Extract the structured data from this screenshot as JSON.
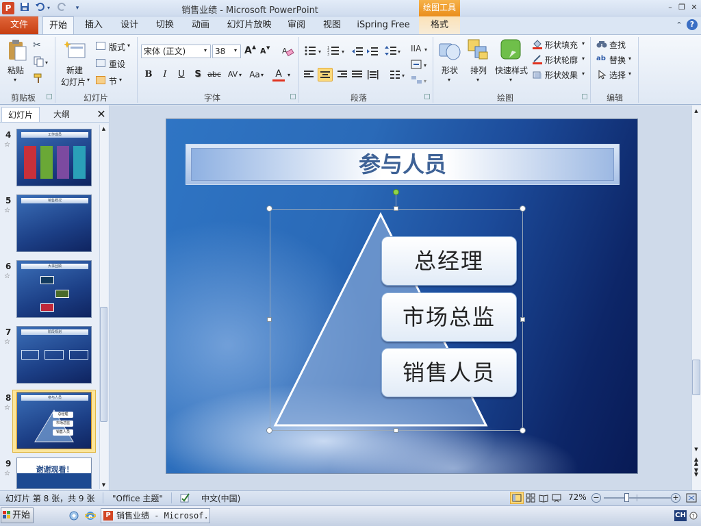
{
  "window": {
    "app_icon": "P",
    "title": "销售业绩 - Microsoft PowerPoint",
    "context_group": "绘图工具",
    "controls": {
      "minimize": "–",
      "restore": "❐",
      "close": "✕"
    },
    "quick_access_icons": [
      "save-icon",
      "undo-icon",
      "redo-icon",
      "customize-icon"
    ]
  },
  "tabs": {
    "file": "文件",
    "items": [
      "开始",
      "插入",
      "设计",
      "切换",
      "动画",
      "幻灯片放映",
      "审阅",
      "视图",
      "iSpring Free",
      "格式"
    ],
    "active": "开始"
  },
  "ribbon": {
    "clipboard": {
      "label": "剪贴板",
      "paste": "粘贴"
    },
    "slides": {
      "label": "幻灯片",
      "new_slide_1": "新建",
      "new_slide_2": "幻灯片",
      "layout": "版式",
      "reset": "重设",
      "section": "节"
    },
    "font": {
      "label": "字体",
      "font_name": "宋体 (正文)",
      "font_size": "38",
      "grow": "A",
      "shrink": "A",
      "bold": "B",
      "italic": "I",
      "underline": "U",
      "shadow": "S",
      "strike": "abc",
      "spacing": "AV",
      "case": "Aa",
      "color": "A"
    },
    "paragraph": {
      "label": "段落"
    },
    "drawing": {
      "label": "绘图",
      "shapes": "形状",
      "arrange": "排列",
      "quick_styles": "快速样式",
      "fill": "形状填充",
      "outline": "形状轮廓",
      "effects": "形状效果"
    },
    "editing": {
      "label": "编辑",
      "find": "查找",
      "replace": "替换",
      "select": "选择"
    }
  },
  "panel": {
    "tabs": {
      "slides": "幻灯片",
      "outline": "大纲",
      "close": "✕"
    },
    "thumbnails": [
      {
        "num": "4",
        "title": "工作成员"
      },
      {
        "num": "5",
        "title": "销售概况"
      },
      {
        "num": "6",
        "title": "大事回顾"
      },
      {
        "num": "7",
        "title": "阶段规划"
      },
      {
        "num": "8",
        "title": "参与人员",
        "selected": true,
        "items": [
          "总经理",
          "市场总监",
          "销售人员"
        ]
      },
      {
        "num": "9",
        "title": "谢谢观看！"
      }
    ]
  },
  "slide": {
    "title": "参与人员",
    "items": [
      "总经理",
      "市场总监",
      "销售人员"
    ]
  },
  "status": {
    "slide_info": "幻灯片 第 8 张，共 9 张",
    "theme": "\"Office 主题\"",
    "language": "中文(中国)",
    "zoom": "72%",
    "zoom_level": 0.72
  },
  "taskbar": {
    "start": "开始",
    "item": "销售业绩 - Microsof...",
    "ime": "CH"
  }
}
